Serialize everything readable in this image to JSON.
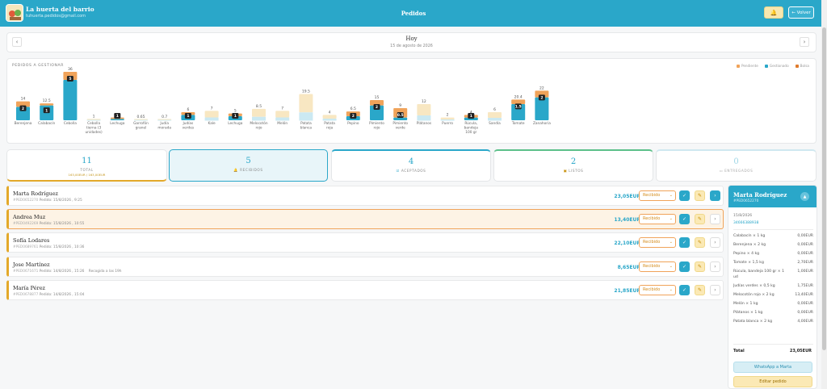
{
  "header": {
    "brand": "La huerta del barrio",
    "email": "tuhuerta.pedidos@gmail.com",
    "title": "Pedidos",
    "back_label": "← Volver",
    "bell_icon": "bell-icon"
  },
  "date_nav": {
    "title": "Hoy",
    "subtitle": "15 de agosto de 2026",
    "prev": "‹",
    "next": "›"
  },
  "chart_section": {
    "title": "PEDIDOS A GESTIONAR",
    "legend": [
      "Pendiente",
      "Gestionado",
      "Bolsa"
    ]
  },
  "chart_data": {
    "type": "bar",
    "title": "PEDIDOS A GESTIONAR",
    "categories": [
      "Berenjena",
      "Calabacín",
      "Cebolla",
      "Cebolla tierna (3 unidades)",
      "Lechuga",
      "Garrofón granel",
      "Judía morada",
      "Judías verdes",
      "Kale",
      "Lechuga",
      "Melocotón rojo",
      "Melón",
      "Patata blanca",
      "Patata roja",
      "Pepino",
      "Pimiento rojo",
      "Pimiento verde",
      "Plátanos",
      "Puerro",
      "Rúcula, bandeja 100 gr",
      "Sandía",
      "Tomate",
      "Zanahoria"
    ],
    "series": [
      {
        "name": "Gestionado",
        "values": [
          10,
          11,
          30,
          0,
          1,
          0,
          0,
          4,
          0,
          3,
          0,
          0,
          0,
          0,
          3,
          11,
          2,
          0,
          0,
          2,
          0,
          12,
          17
        ]
      },
      {
        "name": "Pendiente",
        "values": [
          4,
          1.5,
          6,
          1,
          1,
          0.65,
          0.7,
          2,
          7,
          2,
          8.5,
          7,
          19.5,
          4,
          3.5,
          4,
          7,
          12,
          2,
          2,
          6,
          3.4,
          5
        ]
      }
    ],
    "value_labels": [
      "14",
      "12.5",
      "36",
      "1",
      "1",
      "0.65",
      "0.7",
      "6",
      "7",
      "5",
      "8.5",
      "7",
      "19.5",
      "4",
      "6.5",
      "15",
      "9",
      "12",
      "2",
      "4",
      "6",
      "20.4",
      "22"
    ],
    "bag_counts": [
      "2",
      "1",
      "5",
      "",
      "1",
      "",
      "",
      "1",
      "",
      "1",
      "",
      "",
      "",
      "",
      "2",
      "2",
      "0.5",
      "",
      "",
      "1",
      "",
      "1.5",
      "2"
    ],
    "colors": {
      "Pendiente": "#f0a35a",
      "Gestionado": "#2aa7c9",
      "Bolsa": "#e07b2c",
      "unmanaged": "#cbe9f2",
      "unmanaged_top": "#f8e7c2"
    },
    "ylim": [
      0,
      36
    ]
  },
  "stats": [
    {
      "num": "11",
      "label": "TOTAL",
      "sub": "163,00EUR / 163,00EUR",
      "color": "#2aa7c9"
    },
    {
      "num": "5",
      "label": "RECIBIDOS",
      "icon": "bell-icon",
      "color": "#2aa7c9"
    },
    {
      "num": "4",
      "label": "ACEPTADOS",
      "icon": "check-icon",
      "color": "#2aa7c9"
    },
    {
      "num": "2",
      "label": "LISTOS",
      "icon": "package-icon",
      "color": "#2aa7c9"
    },
    {
      "num": "0",
      "label": "ENTREGADOS",
      "icon": "truck-icon",
      "color": "#9fd6e6"
    }
  ],
  "orders": [
    {
      "name": "Marta Rodríguez",
      "id": "#PED0652270",
      "meta": "Pedido: 15/8/2026 , 9:25",
      "pickup": "",
      "price": "23,05EUR",
      "status": "Recibido",
      "go": "›"
    },
    {
      "name": "Andrea Muz",
      "id": "#PED0492269",
      "meta": "Pedido: 15/8/2026 , 10:55",
      "pickup": "",
      "price": "13,40EUR",
      "status": "Recibido",
      "go": "›"
    },
    {
      "name": "Sofía Lodares",
      "id": "#PED0689761",
      "meta": "Pedido: 15/8/2026 , 10:36",
      "pickup": "",
      "price": "22,10EUR",
      "status": "Recibido",
      "go": "›"
    },
    {
      "name": "Jose Martínez",
      "id": "#PED0671671",
      "meta": "Pedido: 14/8/2026 , 15:26",
      "pickup": "Recogida a las 19h",
      "price": "8,65EUR",
      "status": "Recibido",
      "go": "›"
    },
    {
      "name": "María Pérez",
      "id": "#PED0678877",
      "meta": "Pedido: 14/8/2026 , 15:04",
      "pickup": "",
      "price": "21,85EUR",
      "status": "Recibido",
      "go": "›"
    }
  ],
  "detail": {
    "name": "Marta Rodríguez",
    "id": "#PED0652270",
    "date": "15/8/2026",
    "phone": "34666388938",
    "collapse": "▲",
    "items": [
      {
        "name": "Calabacín × 1 kg",
        "price": "0,00EUR"
      },
      {
        "name": "Berenjena × 2 kg",
        "price": "0,00EUR"
      },
      {
        "name": "Pepino × 4 kg",
        "price": "0,00EUR"
      },
      {
        "name": "Tomate × 1,5 kg",
        "price": "2,70EUR"
      },
      {
        "name": "Rúcula, bandeja 100 gr × 1 ud",
        "price": "1,00EUR"
      },
      {
        "name": "Judías verdes × 0,5 kg",
        "price": "1,75EUR"
      },
      {
        "name": "Melocotón rojo × 2 kg",
        "price": "13,40EUR"
      },
      {
        "name": "Melón × 1 kg",
        "price": "0,00EUR"
      },
      {
        "name": "Plátanos × 1 kg",
        "price": "0,00EUR"
      },
      {
        "name": "Patata blanca × 2 kg",
        "price": "4,00EUR"
      }
    ],
    "total_label": "Total",
    "total": "23,05EUR",
    "whatsapp_label": "WhatsApp a Marta",
    "edit_label": "Editar pedido"
  }
}
